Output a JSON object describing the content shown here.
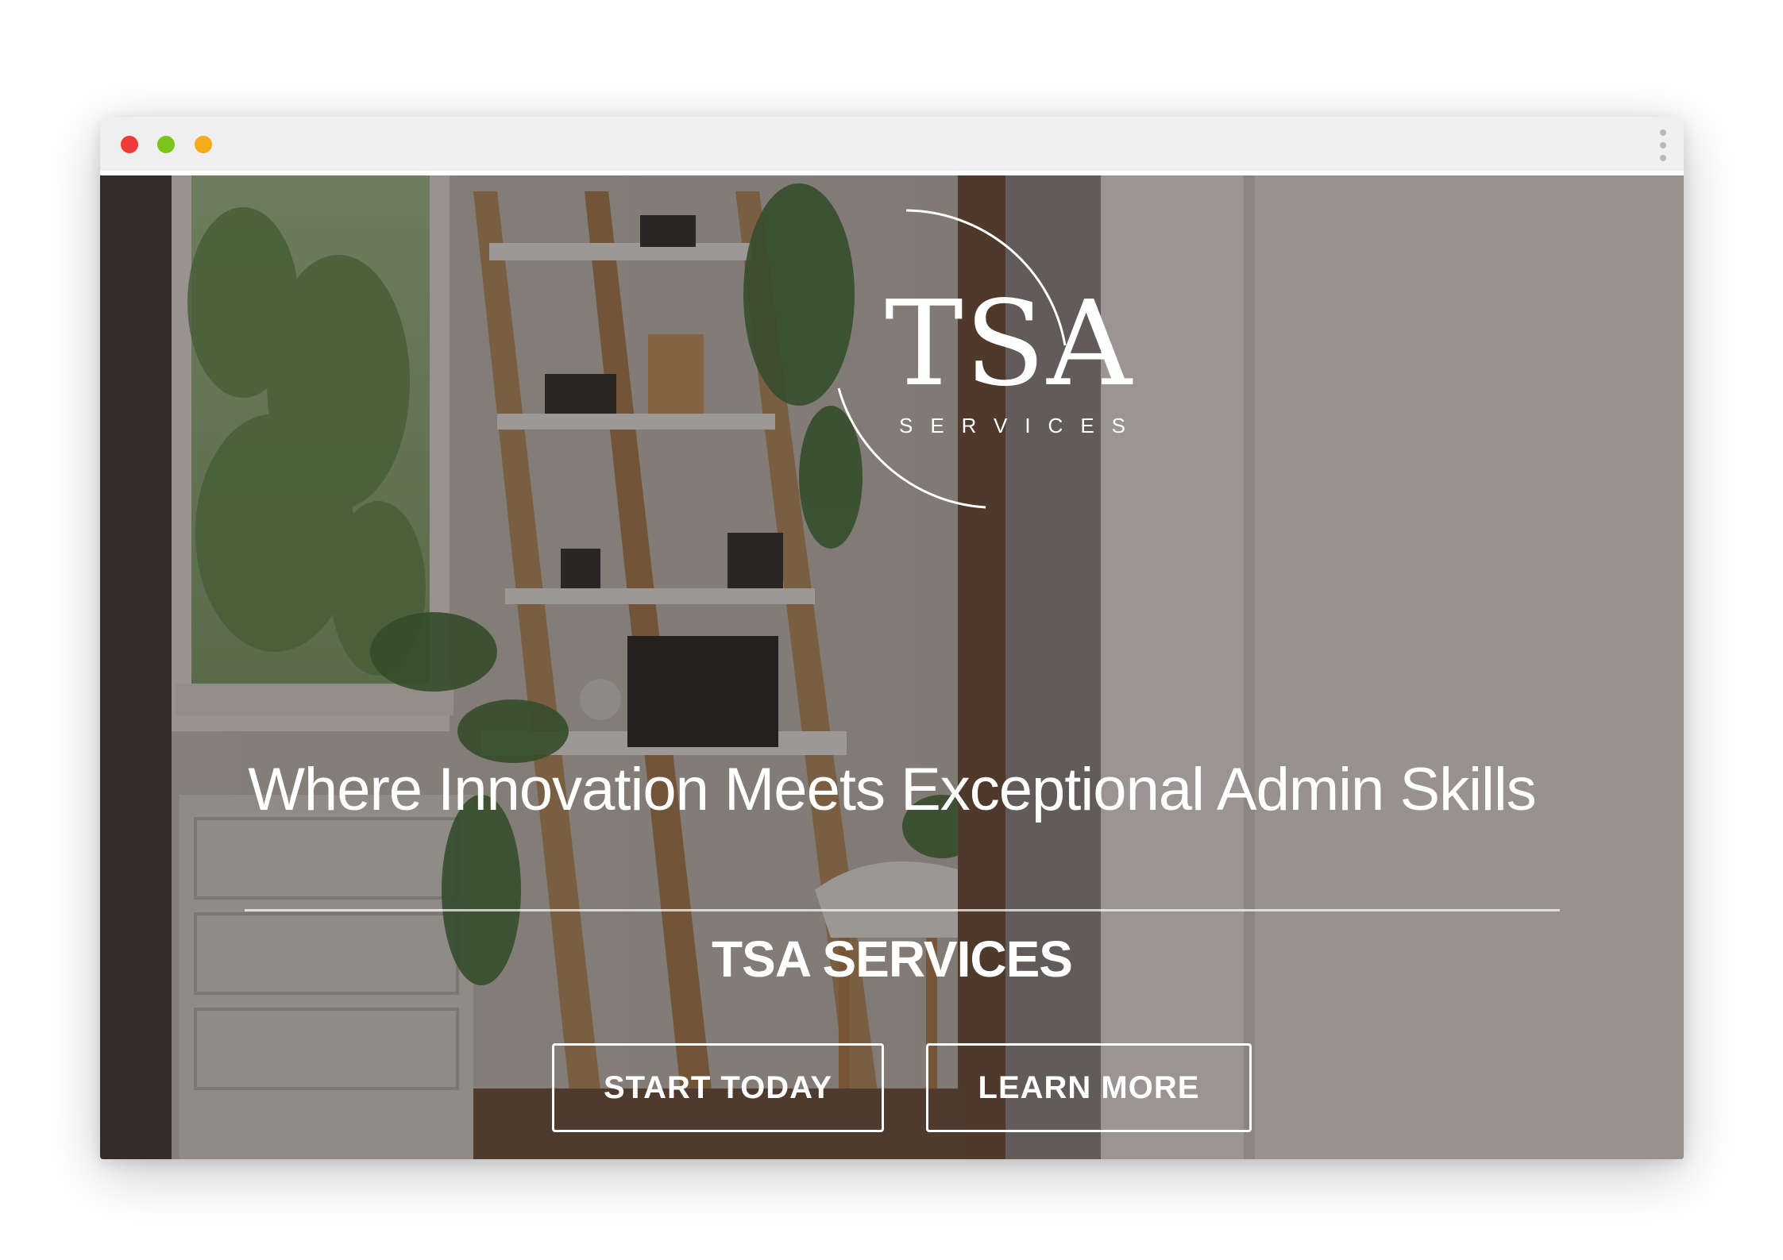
{
  "window": {
    "controls": [
      "close",
      "minimize",
      "maximize"
    ],
    "menu_icon": "kebab-menu-icon"
  },
  "hero": {
    "logo_mark": "TSA",
    "logo_sub": "SERVICES",
    "headline": "Where Innovation Meets Exceptional Admin Skills",
    "brand": "TSA SERVICES",
    "buttons": {
      "start_label": "START TODAY",
      "learn_label": "LEARN MORE"
    }
  },
  "colors": {
    "close": "#ee3b39",
    "minimize": "#7bc41c",
    "maximize": "#f5ab1c",
    "text": "#ffffff"
  }
}
